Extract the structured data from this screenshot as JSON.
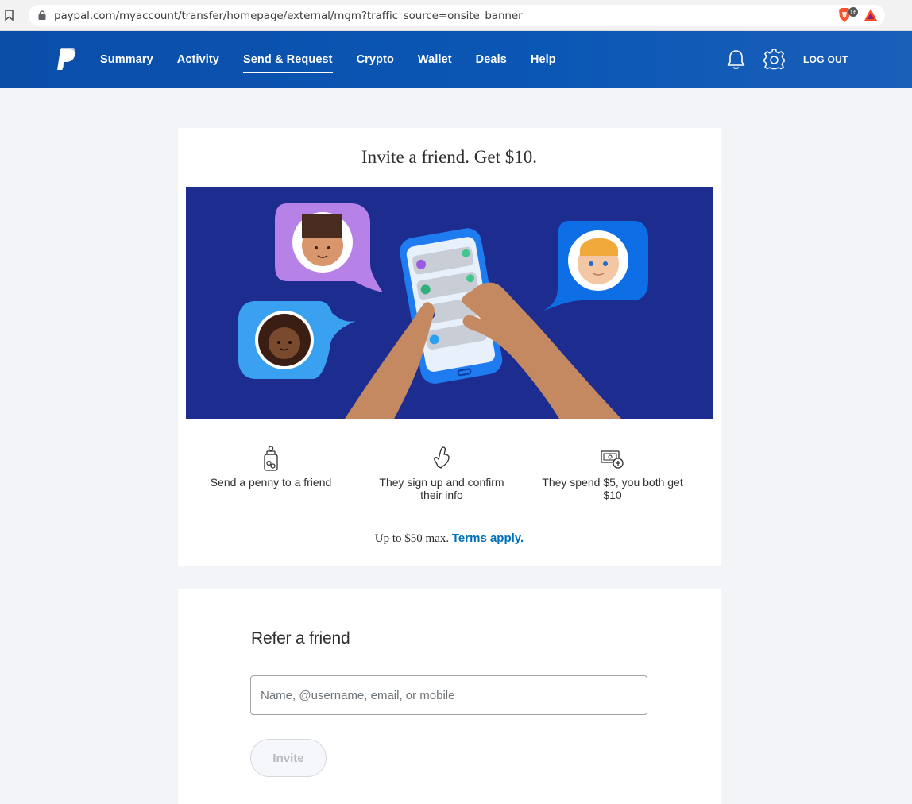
{
  "browser": {
    "url": "paypal.com/myaccount/transfer/homepage/external/mgm?traffic_source=onsite_banner",
    "brave_badge": "16"
  },
  "nav": {
    "items": [
      {
        "label": "Summary"
      },
      {
        "label": "Activity"
      },
      {
        "label": "Send & Request",
        "active": true
      },
      {
        "label": "Crypto"
      },
      {
        "label": "Wallet"
      },
      {
        "label": "Deals"
      },
      {
        "label": "Help"
      }
    ],
    "logout": "LOG OUT"
  },
  "invite": {
    "title": "Invite a friend. Get $10.",
    "steps": [
      {
        "icon": "jar-icon",
        "text": "Send a penny to a friend"
      },
      {
        "icon": "hand-icon",
        "text": "They sign up and confirm their info"
      },
      {
        "icon": "cash-plus-icon",
        "text": "They spend $5, you both get $10"
      }
    ],
    "terms_prefix": "Up to $50 max.",
    "terms_link": "Terms apply."
  },
  "refer": {
    "title": "Refer a friend",
    "input_placeholder": "Name, @username, email, or mobile",
    "input_value": "",
    "button": "Invite"
  },
  "colors": {
    "header": "#0b57b5",
    "hero_bg": "#1d2c8f",
    "link": "#0070ba"
  }
}
